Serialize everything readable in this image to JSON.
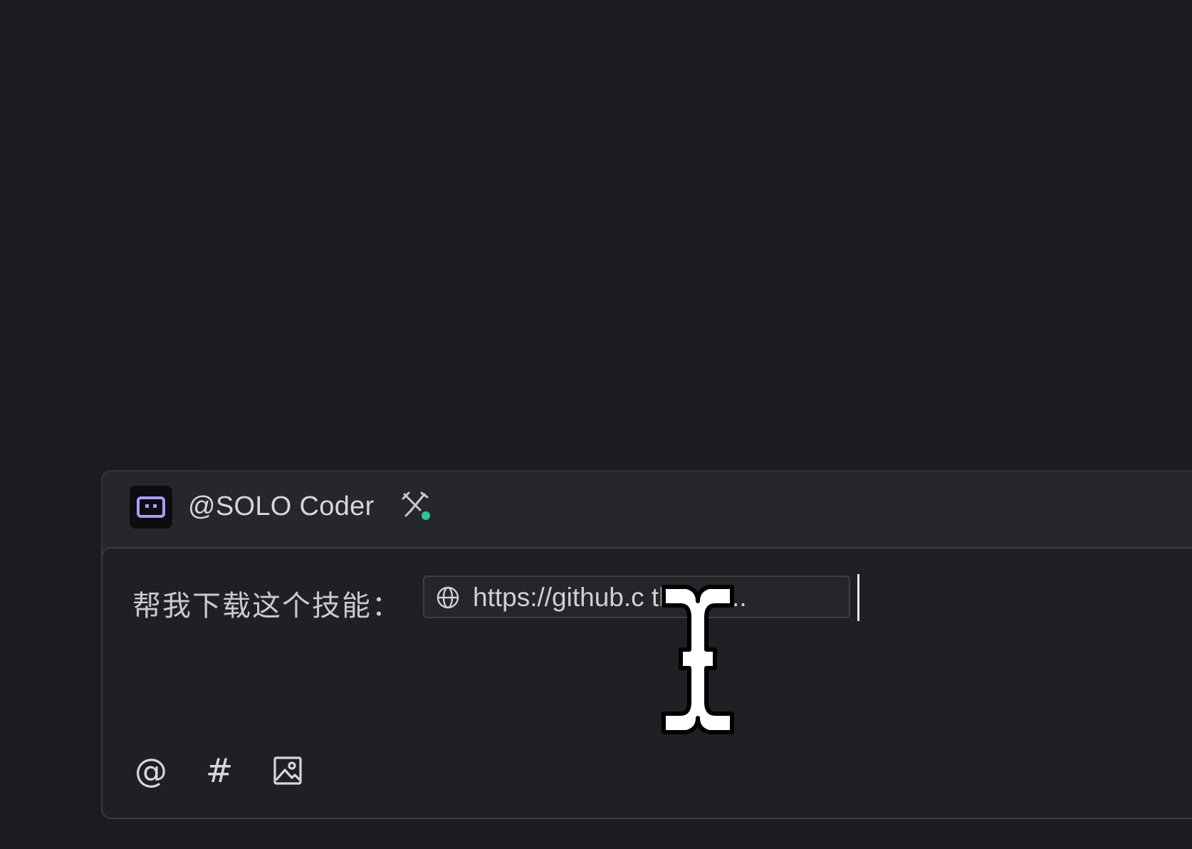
{
  "agent": {
    "name": "@SOLO Coder",
    "avatar_icon": "robot-face-icon",
    "tools_icon": "tools-icon",
    "status_color": "#2ec4a0",
    "avatar_accent": "#a99cff"
  },
  "input": {
    "prompt_text": "帮我下载这个技能：",
    "url_chip": {
      "icon": "globe-icon",
      "text": "https://github.com/obra/superpowers",
      "display_text": "https://github.c    thman..."
    }
  },
  "toolbar": {
    "mention_label": "@",
    "context_label": "#",
    "image_icon": "image-icon"
  }
}
